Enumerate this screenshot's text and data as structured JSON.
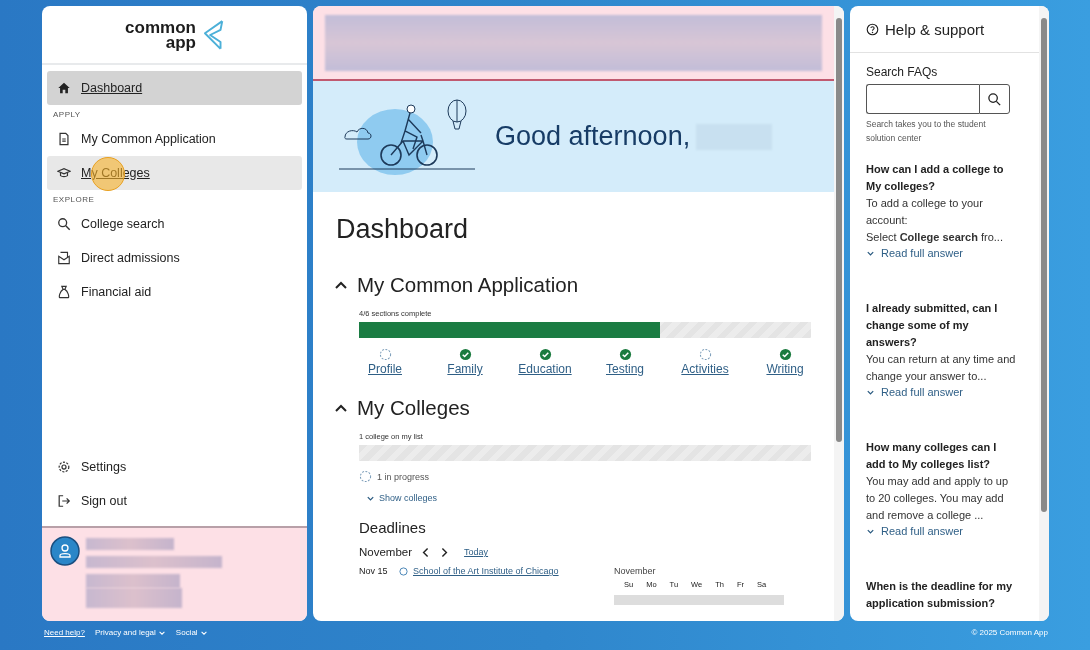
{
  "logo": {
    "line_1": "common",
    "line_2": "app"
  },
  "sidebar": {
    "items": [
      {
        "kind": "link",
        "label": "Dashboard",
        "selected": true,
        "hovered": false
      },
      {
        "kind": "heading",
        "label": "APPLY"
      },
      {
        "kind": "link",
        "label": "My Common Application",
        "selected": false,
        "hovered": false
      },
      {
        "kind": "link",
        "label": "My Colleges",
        "selected": false,
        "hovered": true
      },
      {
        "kind": "heading",
        "label": "EXPLORE"
      },
      {
        "kind": "link",
        "label": "College search",
        "selected": false,
        "hovered": false
      },
      {
        "kind": "link",
        "label": "Direct admissions",
        "selected": false,
        "hovered": false
      },
      {
        "kind": "link",
        "label": "Financial aid",
        "selected": false,
        "hovered": false
      }
    ],
    "bottom_items": [
      {
        "label": "Settings"
      },
      {
        "label": "Sign out"
      }
    ]
  },
  "hero": {
    "greeting": "Good afternoon,"
  },
  "main": {
    "title": "Dashboard",
    "application": {
      "title": "My Common Application",
      "expanded": true,
      "progress_label": "4/6 sections complete",
      "level": 0.667,
      "sections": [
        {
          "label": "Profile",
          "complete": false
        },
        {
          "label": "Family",
          "complete": true
        },
        {
          "label": "Education",
          "complete": true
        },
        {
          "label": "Testing",
          "complete": true
        },
        {
          "label": "Activities",
          "complete": false
        },
        {
          "label": "Writing",
          "complete": true
        }
      ]
    },
    "colleges": {
      "title": "My Colleges",
      "expanded": true,
      "progress_label": "1 college on my list",
      "level": 0,
      "status": "1 in progress",
      "toggle": "Show colleges"
    },
    "deadlines": {
      "title": "Deadlines",
      "month": "November",
      "today": "Today",
      "entries": [
        {
          "date": "Nov 15",
          "college": "School of the Art Institute of Chicago"
        }
      ],
      "calendar": {
        "month": "November",
        "weekdays": [
          "Su",
          "Mo",
          "Tu",
          "We",
          "Th",
          "Fr",
          "Sa"
        ]
      }
    }
  },
  "help": {
    "title": "Help & support",
    "search_label": "Search FAQs",
    "search_hint": "Search takes you to the student solution center",
    "faqs": [
      {
        "question": "How can I add a college to My colleges?",
        "answer": [
          "To add a college to your account:",
          "Select **College search** fro..."
        ],
        "link": "Read full answer"
      },
      {
        "question": "I already submitted, can I change some of my answers?",
        "answer": [
          "You can return at any time and change your answer to..."
        ],
        "link": "Read full answer"
      },
      {
        "question": "How many colleges can I add to My colleges list?",
        "answer": [
          "You may add and apply to up to 20 colleges. You may add and remove a college ..."
        ],
        "link": "Read full answer"
      },
      {
        "question": "When is the deadline for my application submission?"
      }
    ]
  },
  "footer": {
    "links": [
      {
        "label": "Need help?",
        "menu": false
      },
      {
        "label": "Privacy and legal",
        "menu": true
      },
      {
        "label": "Social",
        "menu": true
      }
    ],
    "copyright": "© 2025 Common App"
  }
}
